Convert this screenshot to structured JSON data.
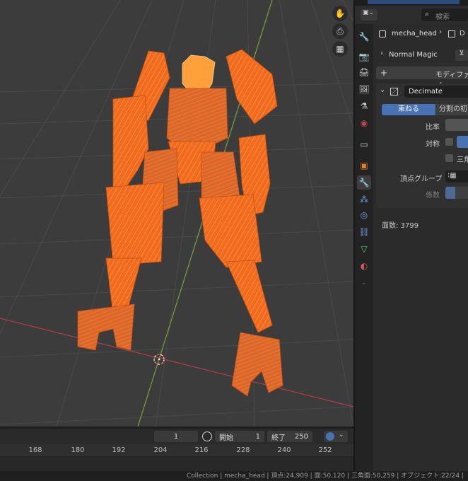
{
  "header": {
    "search_placeholder": "検索",
    "breadcrumb_object": "mecha_head",
    "breadcrumb_next": "D"
  },
  "properties": {
    "object_name": "Normal Magic",
    "add_modifier_label": "モディファイ",
    "modifier": {
      "name": "Decimate",
      "mode_tabs": [
        "束ねる",
        "分割の初"
      ],
      "active_mode": "束ねる",
      "ratio_label": "比率",
      "symmetry_label": "対称",
      "triangulate_label": "三角",
      "vertex_group_label": "頂点グループ",
      "factor_label": "係数",
      "face_count": "面数: 3799"
    }
  },
  "timeline": {
    "current_frame": "1",
    "start_label": "開始",
    "start_value": "1",
    "end_label": "終了",
    "end_value": "250",
    "ruler_ticks": [
      "168",
      "180",
      "192",
      "204",
      "216",
      "228",
      "240",
      "252"
    ]
  },
  "statusbar": {
    "text": "Collection | mecha_head | 頂点:24,909 | 面:50,120 | 三角面:50,259 | オブジェクト:22/24 |"
  },
  "colors": {
    "selection_orange": "#f26a1b",
    "active_yellow": "#ffa13a",
    "active_blue": "#4772b3",
    "x_axis_red": "#a94048",
    "y_axis_green": "#7aa33a"
  },
  "icons": {
    "viewport_nav": [
      "hand-icon",
      "camera-icon",
      "grid-icon"
    ],
    "property_tabs": [
      "tool-icon",
      "render-icon",
      "output-icon",
      "view-layer-icon",
      "scene-icon",
      "world-icon",
      "collection-icon",
      "object-icon",
      "modifier-icon",
      "particles-icon",
      "physics-icon",
      "constraints-icon",
      "data-icon",
      "material-icon"
    ]
  }
}
